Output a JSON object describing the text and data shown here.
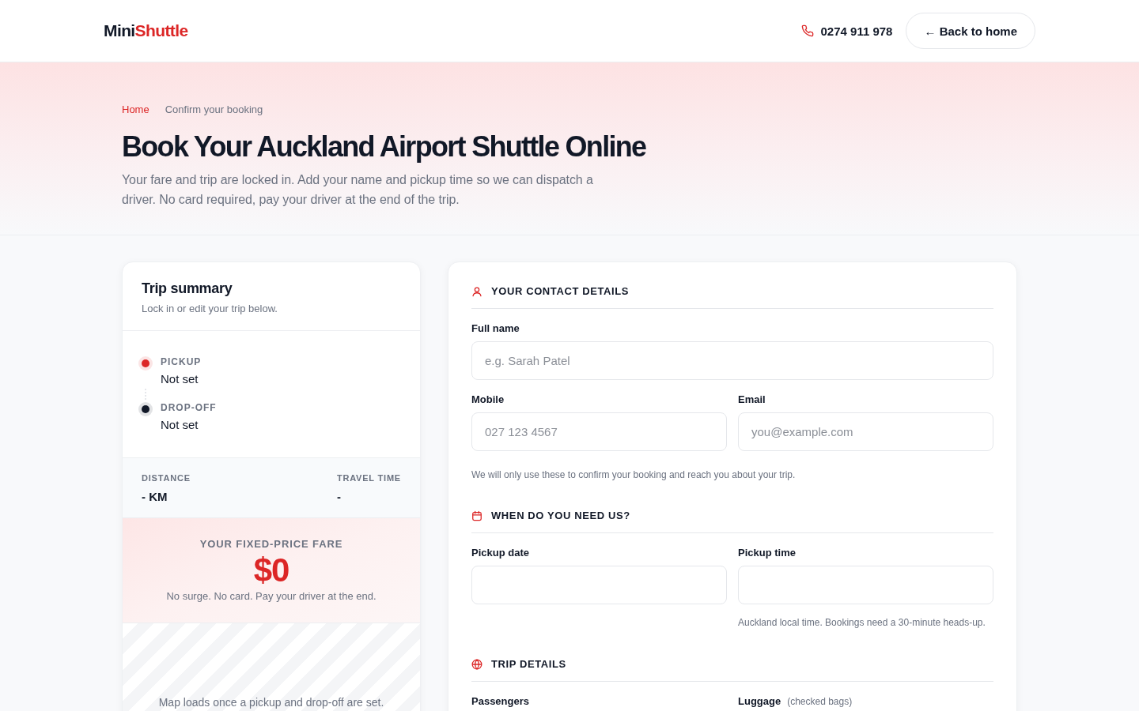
{
  "header": {
    "logo": {
      "part_1": "Mini",
      "part_2": "Shuttle"
    },
    "phone": "0274 911 978",
    "back_button": "← Back to home"
  },
  "hero": {
    "breadcrumb": [
      {
        "label": "Home",
        "kind": "link"
      },
      {
        "label": "Confirm your booking",
        "kind": "current"
      }
    ],
    "title": "Book Your Auckland Airport Shuttle Online",
    "subtitle": "Your fare and trip are locked in. Add your name and pickup time so we can dispatch a driver. No card required, pay your driver at the end of the trip."
  },
  "trip_summary": {
    "title": "Trip summary",
    "subtitle": "Lock in or edit your trip below.",
    "stops": [
      {
        "label": "PICKUP",
        "value": "Not set",
        "color": "#dc2626"
      },
      {
        "label": "DROP-OFF",
        "value": "Not set",
        "color": "#111827"
      }
    ],
    "stats": [
      {
        "label": "DISTANCE",
        "value": "- KM"
      },
      {
        "label": "TRAVEL TIME",
        "value": "-"
      }
    ],
    "fare": {
      "label": "YOUR FIXED-PRICE FARE",
      "amount": "$0",
      "note": "No surge. No card. Pay your driver at the end."
    },
    "map": {
      "message": "Map loads once a pickup and drop-off are set."
    }
  },
  "form": {
    "sections": [
      {
        "title": "YOUR CONTACT DETAILS",
        "rows": [
          [
            {
              "kind": "input",
              "label": "Full name",
              "placeholder": "e.g. Sarah Patel"
            }
          ],
          [
            {
              "kind": "input",
              "label": "Mobile",
              "placeholder": "027 123 4567"
            },
            {
              "kind": "input",
              "label": "Email",
              "placeholder": "you@example.com"
            }
          ]
        ],
        "note": "We will only use these to confirm your booking and reach you about your trip."
      },
      {
        "title": "WHEN DO YOU NEED US?",
        "rows": [
          [
            {
              "kind": "input",
              "label": "Pickup date"
            },
            {
              "kind": "input",
              "label": "Pickup time",
              "hint": "Auckland local time. Bookings need a 30-minute heads-up."
            }
          ]
        ]
      },
      {
        "title": "TRIP DETAILS",
        "rows": [
          [
            {
              "kind": "label",
              "label": "Passengers"
            },
            {
              "kind": "label",
              "label": "Luggage",
              "label_note": "(checked bags)"
            }
          ]
        ]
      }
    ]
  }
}
